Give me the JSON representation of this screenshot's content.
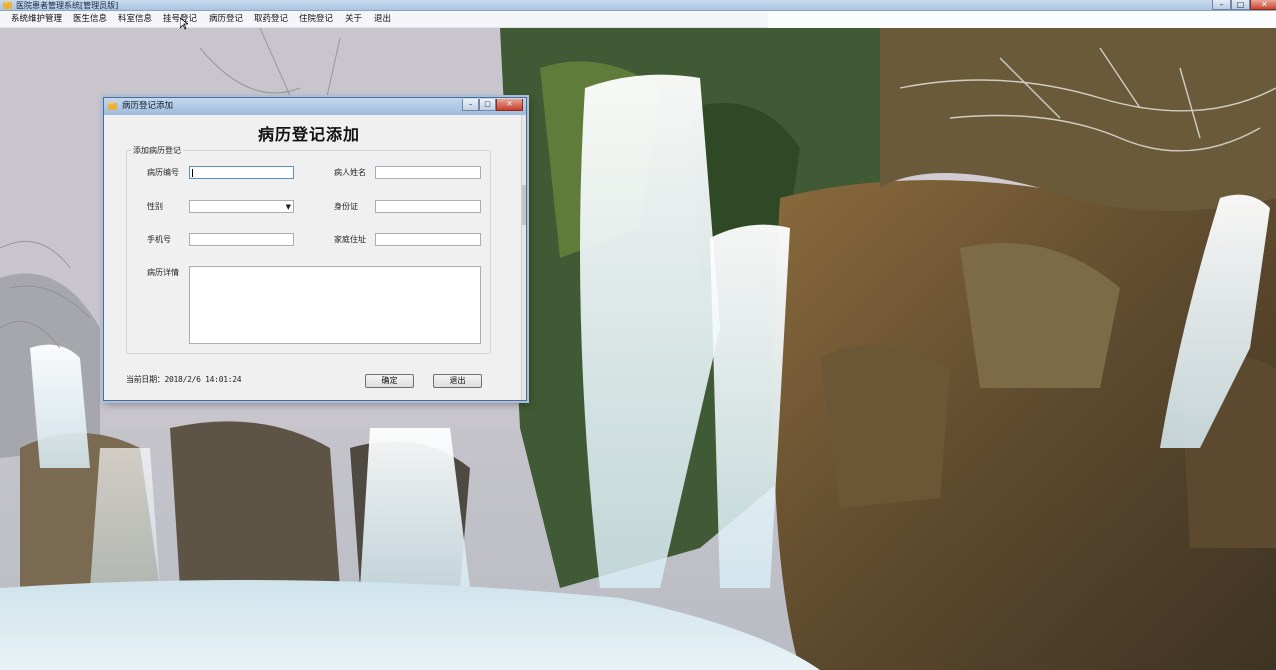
{
  "main_window": {
    "title": "医院患者管理系统[管理员版]",
    "controls": {
      "minimize": "–",
      "maximize": "□",
      "close": "✕"
    }
  },
  "menu": {
    "items": [
      {
        "label": "系统维护管理"
      },
      {
        "label": "医生信息"
      },
      {
        "label": "科室信息"
      },
      {
        "label": "挂号登记"
      },
      {
        "label": "病历登记"
      },
      {
        "label": "取药登记"
      },
      {
        "label": "住院登记"
      },
      {
        "label": "关于"
      },
      {
        "label": "退出"
      }
    ]
  },
  "dialog": {
    "title": "病历登记添加",
    "heading": "病历登记添加",
    "groupbox_legend": "添加病历登记",
    "fields": {
      "record_no": {
        "label": "病历编号",
        "value": ""
      },
      "patient_name": {
        "label": "病人姓名",
        "value": ""
      },
      "gender": {
        "label": "性别",
        "value": ""
      },
      "id_card": {
        "label": "身份证",
        "value": ""
      },
      "phone": {
        "label": "手机号",
        "value": ""
      },
      "address": {
        "label": "家庭住址",
        "value": ""
      },
      "details": {
        "label": "病历详情",
        "value": ""
      }
    },
    "current_date_label": "当前日期：2018/2/6 14:01:24",
    "buttons": {
      "confirm": "确定",
      "exit": "退出"
    },
    "controls": {
      "minimize": "–",
      "maximize": "□",
      "close": "✕"
    }
  },
  "colors": {
    "titlebar": "#a9c4e2",
    "dialog_bg": "#f0f0f0",
    "close_button": "#c8462f"
  }
}
